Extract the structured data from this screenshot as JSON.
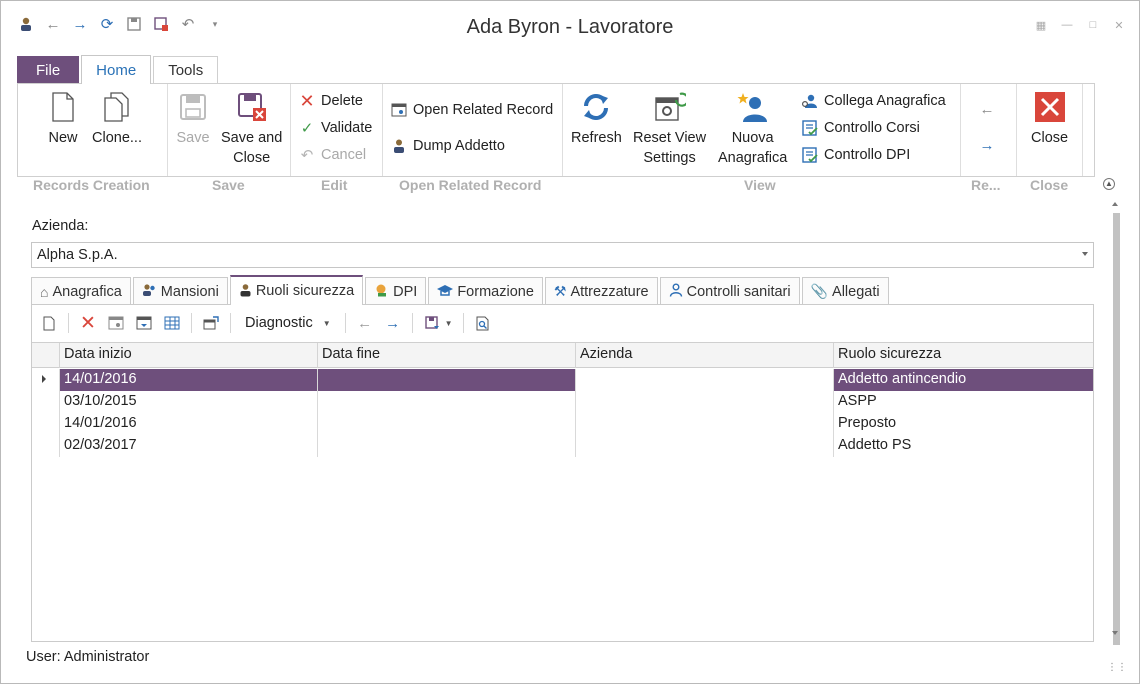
{
  "window": {
    "title": "Ada Byron - Lavoratore"
  },
  "ribbon_tabs": [
    "File",
    "Home",
    "Tools"
  ],
  "ribbon": {
    "new_label": "New",
    "clone_label": "Clone...",
    "save_label": "Save",
    "save_close_label_1": "Save and",
    "save_close_label_2": "Close",
    "delete_label": "Delete",
    "validate_label": "Validate",
    "cancel_label": "Cancel",
    "open_related_label": "Open Related Record",
    "dump_addetto_label": "Dump Addetto",
    "refresh_label": "Refresh",
    "reset_view_label_1": "Reset View",
    "reset_view_label_2": "Settings",
    "nuova_anagrafica_label_1": "Nuova",
    "nuova_anagrafica_label_2": "Anagrafica",
    "collega_label": "Collega Anagrafica",
    "controllo_corsi_label": "Controllo Corsi",
    "controllo_dpi_label": "Controllo DPI",
    "close_label": "Close",
    "groups": {
      "records_creation": "Records Creation",
      "save": "Save",
      "edit": "Edit",
      "open_related": "Open Related Record",
      "view": "View",
      "re": "Re...",
      "close": "Close"
    }
  },
  "form": {
    "azienda_label": "Azienda:",
    "azienda_value": "Alpha S.p.A."
  },
  "subtabs": [
    "Anagrafica",
    "Mansioni",
    "Ruoli sicurezza",
    "DPI",
    "Formazione",
    "Attrezzature",
    "Controlli sanitari",
    "Allegati"
  ],
  "grid_toolbar": {
    "diagnostic_label": "Diagnostic"
  },
  "grid": {
    "columns": [
      "Data inizio",
      "Data fine",
      "Azienda",
      "Ruolo sicurezza"
    ],
    "rows": [
      [
        "14/01/2016",
        "",
        "",
        "Addetto antincendio"
      ],
      [
        "03/10/2015",
        "",
        "",
        "ASPP"
      ],
      [
        "14/01/2016",
        "",
        "",
        "Preposto"
      ],
      [
        "02/03/2017",
        "",
        "",
        "Addetto PS"
      ]
    ]
  },
  "status": {
    "user_text": "User: Administrator"
  },
  "colors": {
    "accent": "#6e4f7c",
    "link_blue": "#2a72b7",
    "delete_red": "#d9463b"
  }
}
